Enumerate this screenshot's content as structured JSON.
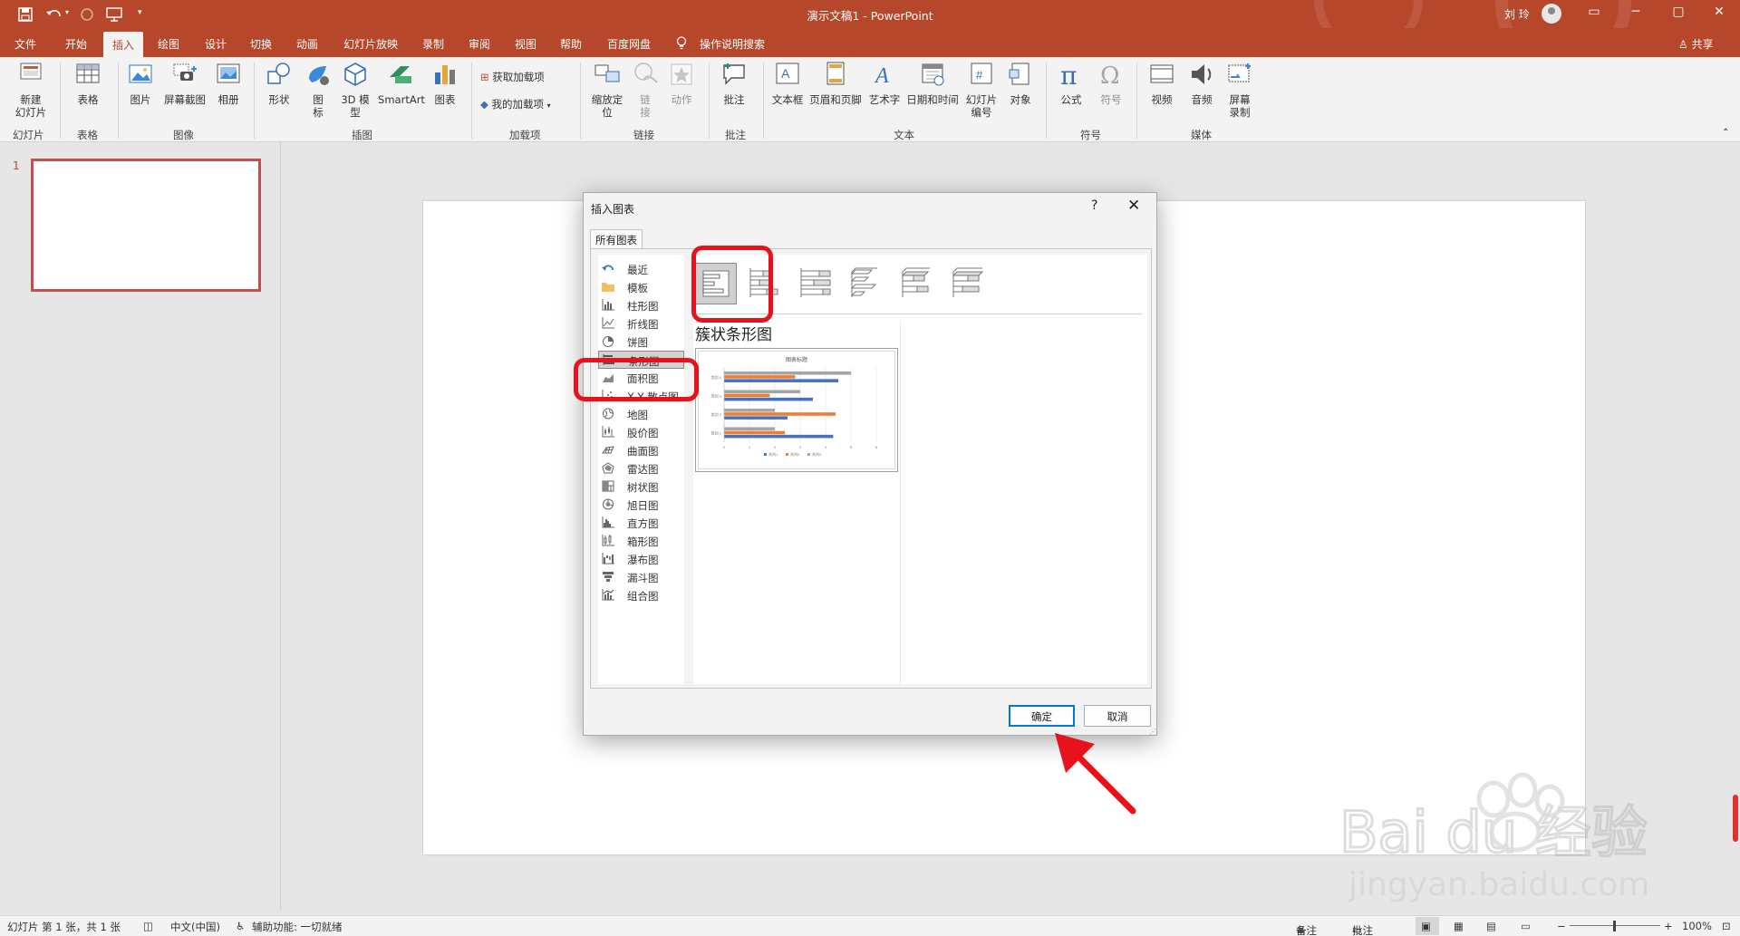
{
  "window": {
    "title": "演示文稿1  -  PowerPoint",
    "user_name": "刘 玲",
    "share_label": "共享"
  },
  "menu": {
    "tabs": [
      {
        "label": "文件"
      },
      {
        "label": "开始"
      },
      {
        "label": "插入"
      },
      {
        "label": "绘图"
      },
      {
        "label": "设计"
      },
      {
        "label": "切换"
      },
      {
        "label": "动画"
      },
      {
        "label": "幻灯片放映"
      },
      {
        "label": "录制"
      },
      {
        "label": "审阅"
      },
      {
        "label": "视图"
      },
      {
        "label": "帮助"
      },
      {
        "label": "百度网盘"
      },
      {
        "label": "操作说明搜索"
      }
    ],
    "active_tab": "插入"
  },
  "ribbon": {
    "new_slide": "新建\n幻灯片",
    "table": "表格",
    "picture": "图片",
    "screenshot": "屏幕截图",
    "album": "相册",
    "shape": "形状",
    "icons": "图\n标",
    "model3d": "3D 模\n型",
    "smartart": "SmartArt",
    "chart": "图表",
    "get_addins": "获取加载项",
    "my_addins": "我的加载项",
    "zoom": "缩放定\n位",
    "link": "链\n接",
    "action": "动作",
    "comment": "批注",
    "textbox": "文本框",
    "header_footer": "页眉和页脚",
    "wordart": "艺术字",
    "datetime": "日期和时间",
    "slide_number": "幻灯片\n编号",
    "object": "对象",
    "equation": "公式",
    "symbol": "符号",
    "video": "视频",
    "audio": "音频",
    "screen_record": "屏幕\n录制",
    "groups": {
      "slides": "幻灯片",
      "tables": "表格",
      "images": "图像",
      "illustrations": "插图",
      "addins": "加载项",
      "links": "链接",
      "comments": "批注",
      "text": "文本",
      "symbols": "符号",
      "media": "媒体"
    }
  },
  "thumbnails": {
    "slide_number": "1"
  },
  "dialog": {
    "title": "插入图表",
    "help": "?",
    "tab": "所有图表",
    "categories": [
      {
        "label": "最近"
      },
      {
        "label": "模板"
      },
      {
        "label": "柱形图"
      },
      {
        "label": "折线图"
      },
      {
        "label": "饼图"
      },
      {
        "label": "条形图"
      },
      {
        "label": "面积图"
      },
      {
        "label": "X Y 散点图"
      },
      {
        "label": "地图"
      },
      {
        "label": "股价图"
      },
      {
        "label": "曲面图"
      },
      {
        "label": "雷达图"
      },
      {
        "label": "树状图"
      },
      {
        "label": "旭日图"
      },
      {
        "label": "直方图"
      },
      {
        "label": "箱形图"
      },
      {
        "label": "瀑布图"
      },
      {
        "label": "漏斗图"
      },
      {
        "label": "组合图"
      }
    ],
    "selected_category": "条形图",
    "subtype_name": "簇状条形图",
    "ok_label": "确定",
    "cancel_label": "取消"
  },
  "preview_chart": {
    "chart_data": {
      "type": "bar",
      "orientation": "horizontal",
      "title": "图表标题",
      "categories": [
        "类别 4",
        "类别 3",
        "类别 2",
        "类别 1"
      ],
      "series": [
        {
          "name": "系列1",
          "color": "#4472c4",
          "values": [
            4.5,
            3.5,
            2.5,
            4.3
          ]
        },
        {
          "name": "系列2",
          "color": "#ed7d31",
          "values": [
            2.8,
            1.8,
            4.4,
            2.4
          ]
        },
        {
          "name": "系列3",
          "color": "#a5a5a5",
          "values": [
            5,
            3,
            2,
            2
          ]
        }
      ],
      "xlim": [
        0,
        6
      ],
      "xticks": [
        "0",
        "1",
        "2",
        "3",
        "4",
        "5",
        "6"
      ],
      "legend": "bottom",
      "grid": true
    }
  },
  "status": {
    "slide_info": "幻灯片 第 1 张，共 1 张",
    "language": "中文(中国)",
    "accessibility": "辅助功能: 一切就绪",
    "notes": "备注",
    "comments": "批注",
    "zoom": "100%"
  },
  "watermark": {
    "text": "Bai du 经验",
    "url": "jingyan.baidu.com"
  },
  "colors": {
    "accent": "#b7472a",
    "highlight": "#e8121c",
    "ok_border": "#0078d4"
  }
}
